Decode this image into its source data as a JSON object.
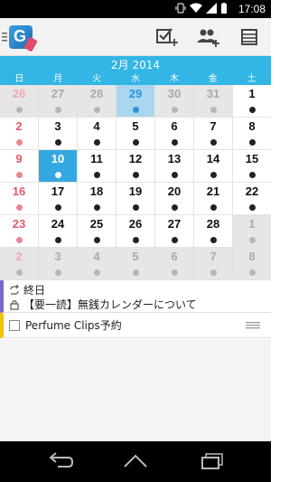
{
  "status_bar": {
    "time": "17:08"
  },
  "calendar": {
    "month_title": "2月 2014",
    "weekdays": [
      "日",
      "月",
      "火",
      "水",
      "木",
      "金",
      "土"
    ],
    "weeks": [
      [
        "26",
        "27",
        "28",
        "29",
        "30",
        "31",
        "1"
      ],
      [
        "2",
        "3",
        "4",
        "5",
        "6",
        "7",
        "8"
      ],
      [
        "9",
        "10",
        "11",
        "12",
        "13",
        "14",
        "15"
      ],
      [
        "16",
        "17",
        "18",
        "19",
        "20",
        "21",
        "22"
      ],
      [
        "23",
        "24",
        "25",
        "26",
        "27",
        "28",
        "1"
      ],
      [
        "2",
        "3",
        "4",
        "5",
        "6",
        "7",
        "8"
      ]
    ]
  },
  "events": {
    "allday_label": "終日",
    "allday_title": "【要一読】無銭カレンダーについて",
    "todo_title": "Perfume Clips予約"
  },
  "colors": {
    "accent": "#33b5e5",
    "sunday": "#e05a6b",
    "allday_bar": "#7b68c8",
    "todo_bar": "#f2c200"
  },
  "icons": {
    "add_task": "add-task-icon",
    "add_contact": "add-contact-icon",
    "list": "list-icon"
  }
}
